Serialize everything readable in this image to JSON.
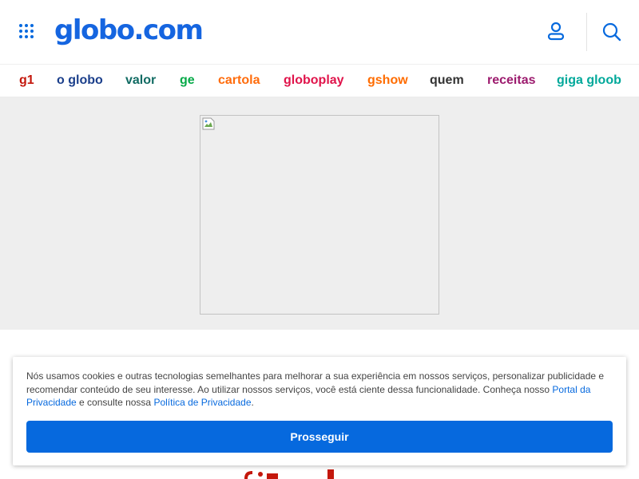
{
  "header": {
    "logo": "globo.com",
    "menu_icon": "grid-menu-icon",
    "user_icon": "user-icon",
    "search_icon": "search-icon"
  },
  "nav": {
    "items": [
      {
        "label": "g1",
        "color": "#c4170c"
      },
      {
        "label": "o globo",
        "color": "#1b3f8b"
      },
      {
        "label": "valor",
        "color": "#116b63"
      },
      {
        "label": "ge",
        "color": "#06aa48"
      },
      {
        "label": "cartola",
        "color": "#ff6c0c"
      },
      {
        "label": "globoplay",
        "color": "#e0144b"
      },
      {
        "label": "gshow",
        "color": "#ff6c00"
      },
      {
        "label": "quem",
        "color": "#333333"
      },
      {
        "label": "receitas",
        "color": "#9c1b6e"
      },
      {
        "label": "giga gloob",
        "color": "#00a89a"
      }
    ]
  },
  "cookie_banner": {
    "text_part1": "Nós usamos cookies e outras tecnologias semelhantes para melhorar a sua experiência em nossos serviços, personalizar publicidade e recomendar conteúdo de seu interesse. Ao utilizar nossos serviços, você está ciente dessa funcionalidade. Conheça nosso ",
    "privacy_portal_link": "Portal da Privacidade",
    "text_part2": " e consulte nossa ",
    "privacy_policy_link": "Política de Privacidade",
    "text_part3": ".",
    "button_label": "Prosseguir"
  },
  "colors": {
    "brand_blue": "#0669de",
    "ad_background": "#eeeeee"
  }
}
